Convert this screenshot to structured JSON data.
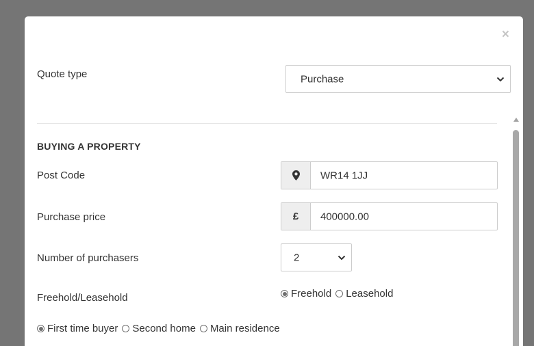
{
  "modal": {
    "close_glyph": "×"
  },
  "quote": {
    "label": "Quote type",
    "selected": "Purchase"
  },
  "section": {
    "heading": "BUYING A PROPERTY"
  },
  "postcode": {
    "label": "Post Code",
    "value": "WR14 1JJ",
    "icon": "map-marker-icon"
  },
  "price": {
    "label": "Purchase price",
    "currency": "£",
    "value": "400000.00"
  },
  "purchasers": {
    "label": "Number of purchasers",
    "selected": "2"
  },
  "tenure": {
    "label": "Freehold/Leasehold",
    "options": [
      "Freehold",
      "Leasehold"
    ],
    "selected": "Freehold"
  },
  "buyer_type": {
    "options": [
      "First time buyer",
      "Second home",
      "Main residence"
    ],
    "selected": "First time buyer"
  }
}
